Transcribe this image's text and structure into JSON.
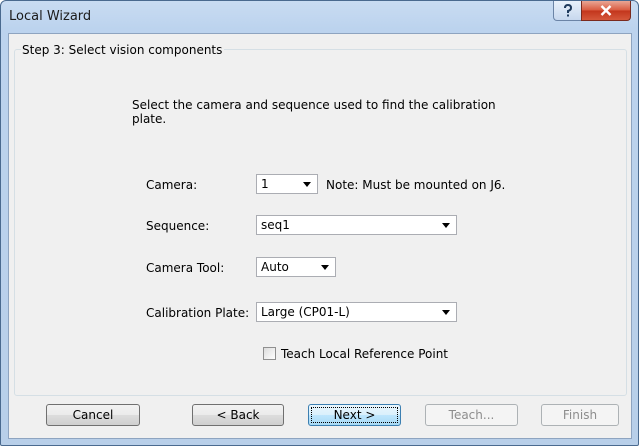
{
  "window": {
    "title": "Local Wizard",
    "help_glyph": "?",
    "close_glyph": "x"
  },
  "step": {
    "title": "Step 3: Select vision components"
  },
  "instruction": "Select the camera and sequence used to find the calibration plate.",
  "fields": {
    "camera": {
      "label": "Camera:",
      "value": "1",
      "note": "Note: Must be mounted on J6."
    },
    "sequence": {
      "label": "Sequence:",
      "value": "seq1"
    },
    "camera_tool": {
      "label": "Camera Tool:",
      "value": "Auto"
    },
    "calibration_plate": {
      "label": "Calibration Plate:",
      "value": "Large (CP01-L)"
    }
  },
  "teach_checkbox": {
    "label": "Teach Local Reference Point",
    "checked": false
  },
  "buttons": {
    "cancel": "Cancel",
    "back": "< Back",
    "next": "Next >",
    "teach": "Teach...",
    "finish": "Finish"
  },
  "icons": [
    "help-icon",
    "close-icon",
    "dropdown-arrow-icon",
    "checkbox"
  ]
}
